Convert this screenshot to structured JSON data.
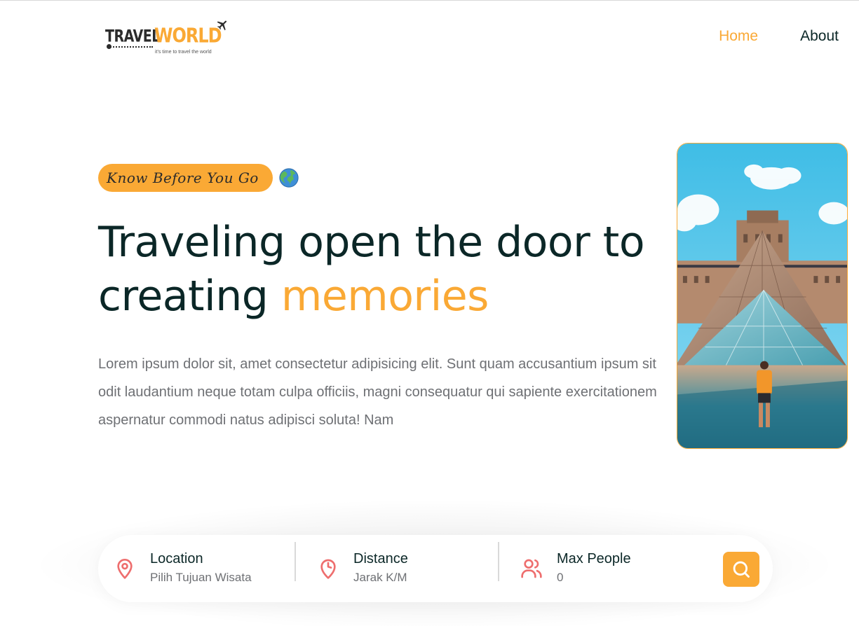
{
  "logo": {
    "brand_part1": "TRAVEL",
    "brand_part2": "WORLD",
    "tagline": "it's time to travel the world",
    "icon": "airplane-icon"
  },
  "nav": {
    "items": [
      {
        "label": "Home",
        "active": true
      },
      {
        "label": "About",
        "active": false
      }
    ]
  },
  "hero": {
    "badge": "Know Before You Go",
    "badge_icon": "globe-emoji-icon",
    "headline_line1": "Traveling open the door to",
    "headline_line2_prefix": "creating ",
    "headline_highlight": "memories",
    "description": "Lorem ipsum dolor sit, amet consectetur adipisicing elit. Sunt quam accusantium ipsum sit odit laudantium neque totam culpa officiis, magni consequatur qui sapiente exercitationem aspernatur commodi natus adipisci soluta! Nam",
    "image": "louvre-pyramid-photo"
  },
  "search": {
    "fields": [
      {
        "label": "Location",
        "value": "Pilih Tujuan Wisata",
        "icon": "map-pin-icon"
      },
      {
        "label": "Distance",
        "value": "Jarak K/M",
        "icon": "clock-icon"
      },
      {
        "label": "Max People",
        "value": "0",
        "icon": "group-icon"
      }
    ],
    "button_icon": "search-icon"
  },
  "colors": {
    "accent": "#faa935",
    "heading": "#0b2727",
    "text": "#6e7074",
    "icon": "#ee6e6e"
  }
}
